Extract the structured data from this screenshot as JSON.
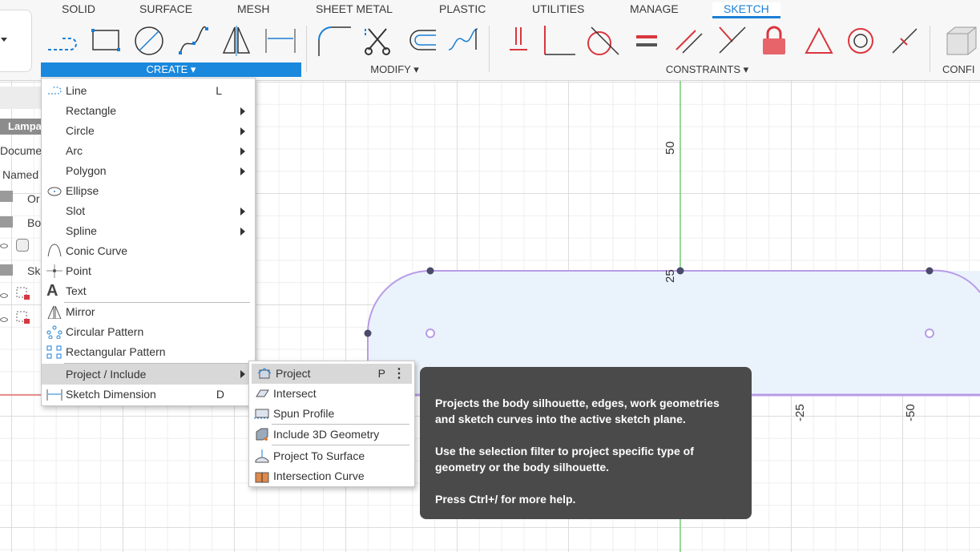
{
  "tabs": [
    {
      "label": "SOLID"
    },
    {
      "label": "SURFACE"
    },
    {
      "label": "MESH"
    },
    {
      "label": "SHEET METAL"
    },
    {
      "label": "PLASTIC"
    },
    {
      "label": "UTILITIES"
    },
    {
      "label": "MANAGE"
    },
    {
      "label": "SKETCH"
    }
  ],
  "groups": {
    "create": "CREATE ▾",
    "modify": "MODIFY ▾",
    "constraints": "CONSTRAINTS ▾",
    "confi": "CONFI"
  },
  "browser": {
    "lampa": "Lampa",
    "document": "Docume",
    "named": "Named",
    "origin": "Or",
    "bodies": "Bo",
    "sketches": "Sk"
  },
  "create_menu": {
    "items": [
      {
        "label": "Line",
        "shortcut": "L"
      },
      {
        "label": "Rectangle"
      },
      {
        "label": "Circle"
      },
      {
        "label": "Arc"
      },
      {
        "label": "Polygon"
      },
      {
        "label": "Ellipse"
      },
      {
        "label": "Slot"
      },
      {
        "label": "Spline"
      },
      {
        "label": "Conic Curve"
      },
      {
        "label": "Point"
      },
      {
        "label": "Text"
      },
      {
        "label": "Mirror"
      },
      {
        "label": "Circular Pattern"
      },
      {
        "label": "Rectangular Pattern"
      },
      {
        "label": "Project / Include"
      },
      {
        "label": "Sketch Dimension",
        "shortcut": "D"
      }
    ]
  },
  "project_menu": {
    "items": [
      {
        "label": "Project",
        "shortcut": "P"
      },
      {
        "label": "Intersect"
      },
      {
        "label": "Spun Profile"
      },
      {
        "label": "Include 3D Geometry"
      },
      {
        "label": "Project To Surface"
      },
      {
        "label": "Intersection Curve"
      }
    ]
  },
  "tooltip": {
    "p1": "Projects the body silhouette, edges, work geometries and sketch curves into the active sketch plane.",
    "p2": "Use the selection filter to project specific type of geometry or the body silhouette.",
    "p3": "Press Ctrl+/ for more help."
  },
  "axis_labels": {
    "y50": "50",
    "y25": "25",
    "xm25": "-25",
    "xm50": "-50"
  },
  "colors": {
    "accent": "#1a88dd",
    "sketch": "#b08ee0",
    "profile_fill": "#eaf3fc",
    "constraint_red": "#d9363e",
    "y_axis": "#66cc66"
  }
}
